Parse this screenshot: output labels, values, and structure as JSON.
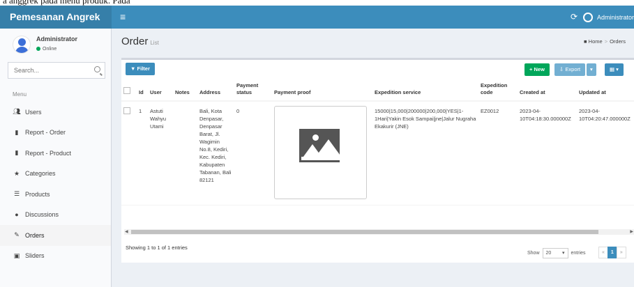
{
  "caption_fragment": "a anggrek  pada  menu  produk.  Pada",
  "app": {
    "brand": "Pemesanan Angrek",
    "user_label": "Administrator"
  },
  "sidebar": {
    "user": {
      "name": "Administrator",
      "status": "Online"
    },
    "search_placeholder": "Search...",
    "menu_header": "Menu",
    "items": [
      {
        "label": "Users",
        "icon": "users-icon"
      },
      {
        "label": "Report - Order",
        "icon": "file-icon"
      },
      {
        "label": "Report - Product",
        "icon": "file-icon"
      },
      {
        "label": "Categories",
        "icon": "star-icon"
      },
      {
        "label": "Products",
        "icon": "list-icon"
      },
      {
        "label": "Discussions",
        "icon": "comments-icon"
      },
      {
        "label": "Orders",
        "icon": "pencil-icon",
        "active": true
      },
      {
        "label": "Sliders",
        "icon": "image-icon"
      }
    ]
  },
  "page": {
    "title": "Order",
    "subtitle": "List",
    "breadcrumb": [
      "Home",
      "Orders"
    ]
  },
  "toolbar": {
    "filter": "Filter",
    "new": "New",
    "export": "Export"
  },
  "table": {
    "columns": [
      "Id",
      "User",
      "Notes",
      "Address",
      "Payment status",
      "Payment proof",
      "Expedition service",
      "Expedition code",
      "Created at",
      "Updated at"
    ],
    "rows": [
      {
        "id": "1",
        "user": "Astuti Wahyu Utami",
        "notes": "",
        "address": "Bali, Kota Denpasar, Denpasar Barat, Jl. Wagimin No.8, Kediri, Kec. Kediri, Kabupaten Tabanan, Bali 82121",
        "payment_status": "0",
        "expedition_service": "15000|15,000|200000|200,000|YES|1-1Hari|Yakin Esok Sampai|jne|Jalur Nugraha Ekakurir (JNE)",
        "expedition_code": "EZ0012",
        "created_at": "2023-04-10T04:18:30.000000Z",
        "updated_at": "2023-04-10T04:20:47.000000Z"
      }
    ]
  },
  "footer": {
    "showing": "Showing 1 to 1 of 1 entries",
    "show_label": "Show",
    "page_length": "20",
    "entries_label": "entries",
    "prev": "«",
    "current_page": "1",
    "next": "»"
  }
}
